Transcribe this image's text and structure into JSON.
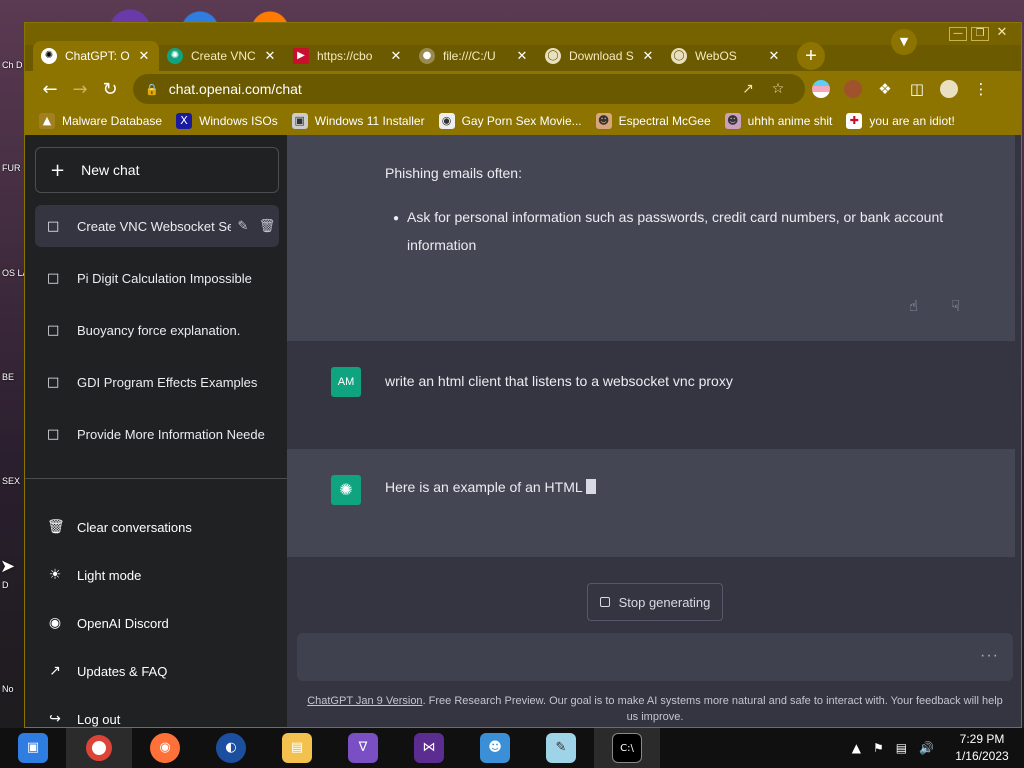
{
  "desktop": {
    "labels": [
      "Ch D",
      "FUR",
      "OS LA",
      "BE",
      "SEX",
      "D",
      "No"
    ]
  },
  "browser": {
    "tabs": [
      {
        "title": "ChatGPT: O",
        "active": true
      },
      {
        "title": "Create VNC",
        "active": false
      },
      {
        "title": "https://cbo",
        "active": false
      },
      {
        "title": "file:///C:/U",
        "active": false
      },
      {
        "title": "Download S",
        "active": false
      },
      {
        "title": "WebOS",
        "active": false
      }
    ],
    "url": "chat.openai.com/chat",
    "bookmarks": [
      "Malware Database",
      "Windows ISOs",
      "Windows 11 Installer",
      "Gay Porn Sex Movie...",
      "Espectral McGee",
      "uhhh anime shit",
      "you are an idiot!"
    ]
  },
  "sidebar": {
    "new_chat": "New chat",
    "conversations": [
      "Create VNC Websocket Se",
      "Pi Digit Calculation Impossible",
      "Buoyancy force explanation.",
      "GDI Program Effects Examples",
      "Provide More Information Neede"
    ],
    "actions": [
      {
        "label": "Clear conversations",
        "icon": "trash-icon"
      },
      {
        "label": "Light mode",
        "icon": "sun-icon"
      },
      {
        "label": "OpenAI Discord",
        "icon": "discord-icon"
      },
      {
        "label": "Updates & FAQ",
        "icon": "external-link-icon"
      },
      {
        "label": "Log out",
        "icon": "logout-icon"
      }
    ]
  },
  "chat": {
    "prev_heading": "Phishing emails often:",
    "prev_bullet_line1": "Ask for personal information such as passwords, credit card numbers, or bank account",
    "prev_bullet_line2": "information",
    "user_avatar": "AM",
    "user_message": "write an html client that listens to a websocket vnc proxy",
    "assistant_message": "Here is an example of an HTML",
    "stop_button": "Stop generating",
    "footnote_link": "ChatGPT Jan 9 Version",
    "footnote_text": ". Free Research Preview. Our goal is to make AI systems more natural and safe to interact with. Your feedback will help us improve."
  },
  "taskbar": {
    "time": "7:29 PM",
    "date": "1/16/2023"
  },
  "colors": {
    "window_chrome": "#8d7400",
    "sidebar_bg": "#202123",
    "chat_bg": "#343541",
    "assistant_bg": "#444654",
    "avatar_green": "#10a37f"
  }
}
